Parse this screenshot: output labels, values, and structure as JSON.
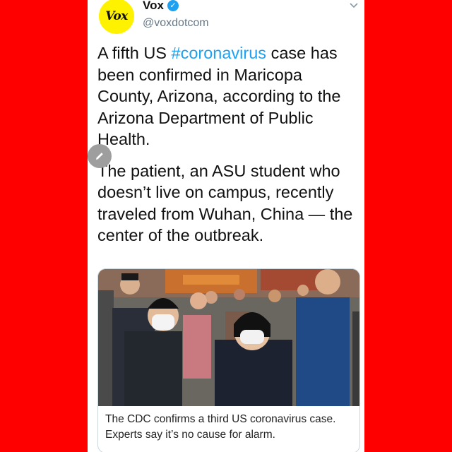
{
  "tweet": {
    "avatar_text": "Vox",
    "display_name": "Vox",
    "handle": "@voxdotcom",
    "verified_mark": "✓",
    "menu_icon": "chevron-down-icon",
    "paragraph1": {
      "before": "A fifth US ",
      "hashtag": "#coronavirus",
      "after": " case has been confirmed in Maricopa County, Arizona, according to the Arizona Department of Public Health."
    },
    "paragraph2": "The patient, an ASU student who doesn’t live on campus, recently traveled from Wuhan, China — the center of the outbreak.",
    "link_card": {
      "caption": "The CDC confirms a third US coronavirus case. Experts say it’s no cause for alarm."
    }
  },
  "colors": {
    "background": "#ff0000",
    "avatar": "#fff200",
    "hashtag": "#1da1f2",
    "verified": "#1da1f2"
  }
}
